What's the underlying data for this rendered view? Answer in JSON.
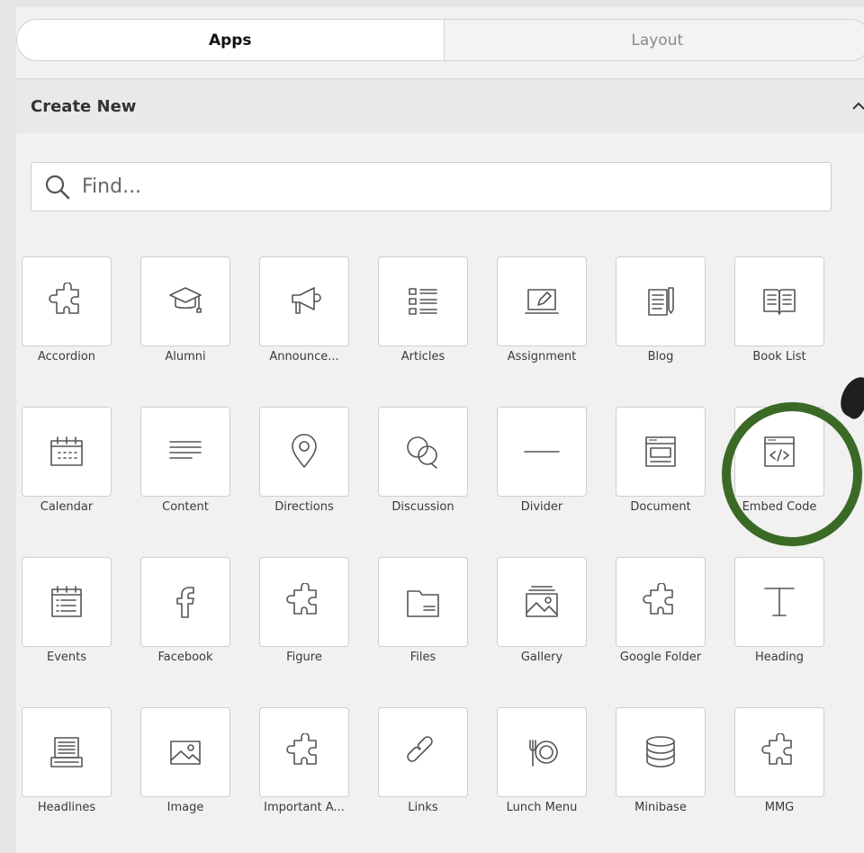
{
  "tabs": [
    {
      "label": "Apps",
      "active": true
    },
    {
      "label": "Layout",
      "active": false
    }
  ],
  "section": {
    "title": "Create New"
  },
  "search": {
    "placeholder": "Find..."
  },
  "colors": {
    "highlight_circle": "#3b6a27"
  },
  "apps": [
    {
      "label": "Accordion",
      "icon": "puzzle-icon"
    },
    {
      "label": "Alumni",
      "icon": "graduation-cap-icon"
    },
    {
      "label": "Announce...",
      "icon": "megaphone-icon"
    },
    {
      "label": "Articles",
      "icon": "articles-list-icon"
    },
    {
      "label": "Assignment",
      "icon": "assignment-icon"
    },
    {
      "label": "Blog",
      "icon": "blog-icon"
    },
    {
      "label": "Book List",
      "icon": "open-book-icon"
    },
    {
      "label": "Calendar",
      "icon": "calendar-icon"
    },
    {
      "label": "Content",
      "icon": "text-lines-icon"
    },
    {
      "label": "Directions",
      "icon": "map-pin-icon"
    },
    {
      "label": "Discussion",
      "icon": "chat-bubbles-icon"
    },
    {
      "label": "Divider",
      "icon": "horizontal-line-icon"
    },
    {
      "label": "Document",
      "icon": "document-icon"
    },
    {
      "label": "Embed Code",
      "icon": "embed-code-icon"
    },
    {
      "label": "Events",
      "icon": "events-list-icon"
    },
    {
      "label": "Facebook",
      "icon": "facebook-icon"
    },
    {
      "label": "Figure",
      "icon": "puzzle-icon"
    },
    {
      "label": "Files",
      "icon": "folder-icon"
    },
    {
      "label": "Gallery",
      "icon": "gallery-icon"
    },
    {
      "label": "Google Folder",
      "icon": "puzzle-icon"
    },
    {
      "label": "Heading",
      "icon": "text-heading-icon"
    },
    {
      "label": "Headlines",
      "icon": "headlines-icon"
    },
    {
      "label": "Image",
      "icon": "image-icon"
    },
    {
      "label": "Important A...",
      "icon": "puzzle-icon"
    },
    {
      "label": "Links",
      "icon": "link-icon"
    },
    {
      "label": "Lunch Menu",
      "icon": "plate-fork-icon"
    },
    {
      "label": "Minibase",
      "icon": "database-icon"
    },
    {
      "label": "MMG",
      "icon": "puzzle-icon"
    }
  ]
}
